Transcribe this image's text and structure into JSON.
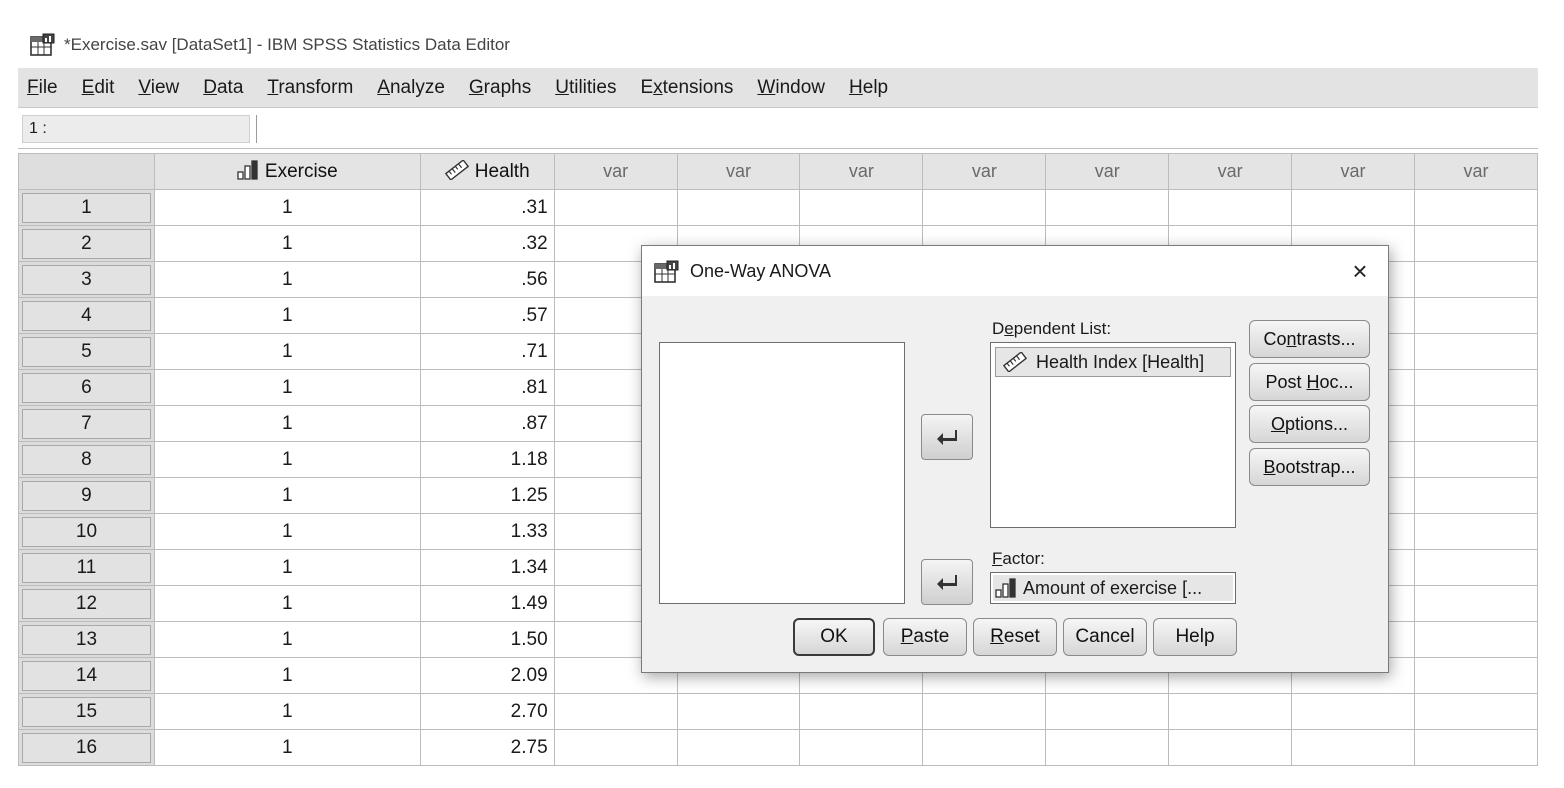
{
  "window": {
    "title": "*Exercise.sav [DataSet1] - IBM SPSS Statistics Data Editor"
  },
  "menu": [
    {
      "pre": "",
      "u": "F",
      "post": "ile"
    },
    {
      "pre": "",
      "u": "E",
      "post": "dit"
    },
    {
      "pre": "",
      "u": "V",
      "post": "iew"
    },
    {
      "pre": "",
      "u": "D",
      "post": "ata"
    },
    {
      "pre": "",
      "u": "T",
      "post": "ransform"
    },
    {
      "pre": "",
      "u": "A",
      "post": "nalyze"
    },
    {
      "pre": "",
      "u": "G",
      "post": "raphs"
    },
    {
      "pre": "",
      "u": "U",
      "post": "tilities"
    },
    {
      "pre": "E",
      "u": "x",
      "post": "tensions"
    },
    {
      "pre": "",
      "u": "W",
      "post": "indow"
    },
    {
      "pre": "",
      "u": "H",
      "post": "elp"
    }
  ],
  "cell_editor": {
    "reference": "1 :",
    "value": ""
  },
  "grid": {
    "columns": [
      "Exercise",
      "Health",
      "var",
      "var",
      "var",
      "var",
      "var",
      "var",
      "var",
      "var"
    ],
    "rows": [
      {
        "n": "1",
        "exercise": "1",
        "health": ".31"
      },
      {
        "n": "2",
        "exercise": "1",
        "health": ".32"
      },
      {
        "n": "3",
        "exercise": "1",
        "health": ".56"
      },
      {
        "n": "4",
        "exercise": "1",
        "health": ".57"
      },
      {
        "n": "5",
        "exercise": "1",
        "health": ".71"
      },
      {
        "n": "6",
        "exercise": "1",
        "health": ".81"
      },
      {
        "n": "7",
        "exercise": "1",
        "health": ".87"
      },
      {
        "n": "8",
        "exercise": "1",
        "health": "1.18"
      },
      {
        "n": "9",
        "exercise": "1",
        "health": "1.25"
      },
      {
        "n": "10",
        "exercise": "1",
        "health": "1.33"
      },
      {
        "n": "11",
        "exercise": "1",
        "health": "1.34"
      },
      {
        "n": "12",
        "exercise": "1",
        "health": "1.49"
      },
      {
        "n": "13",
        "exercise": "1",
        "health": "1.50"
      },
      {
        "n": "14",
        "exercise": "1",
        "health": "2.09"
      },
      {
        "n": "15",
        "exercise": "1",
        "health": "2.70"
      },
      {
        "n": "16",
        "exercise": "1",
        "health": "2.75"
      }
    ]
  },
  "dialog": {
    "title": "One-Way ANOVA",
    "close": "×",
    "dependent_label": {
      "pre": "D",
      "u": "e",
      "post": "pendent List:"
    },
    "dependent_item": "Health Index [Health]",
    "factor_label": {
      "pre": "",
      "u": "F",
      "post": "actor:"
    },
    "factor_item": "Amount of exercise [...",
    "side_buttons": {
      "contrasts": {
        "pre": "Co",
        "u": "n",
        "post": "trasts..."
      },
      "posthoc": {
        "pre": "Post ",
        "u": "H",
        "post": "oc..."
      },
      "options": {
        "pre": "",
        "u": "O",
        "post": "ptions..."
      },
      "bootstrap": {
        "pre": "",
        "u": "B",
        "post": "ootstrap..."
      }
    },
    "bottom_buttons": {
      "ok": {
        "pre": "OK",
        "u": "",
        "post": ""
      },
      "paste": {
        "pre": "",
        "u": "P",
        "post": "aste"
      },
      "reset": {
        "pre": "",
        "u": "R",
        "post": "eset"
      },
      "cancel": {
        "pre": "Cancel",
        "u": "",
        "post": ""
      },
      "help": {
        "pre": "Help",
        "u": "",
        "post": ""
      }
    }
  },
  "icons": {
    "app": "spss-data-editor-icon",
    "ordinal": "ordinal-measure-icon",
    "scale": "scale-measure-icon",
    "move": "move-arrow-icon"
  }
}
